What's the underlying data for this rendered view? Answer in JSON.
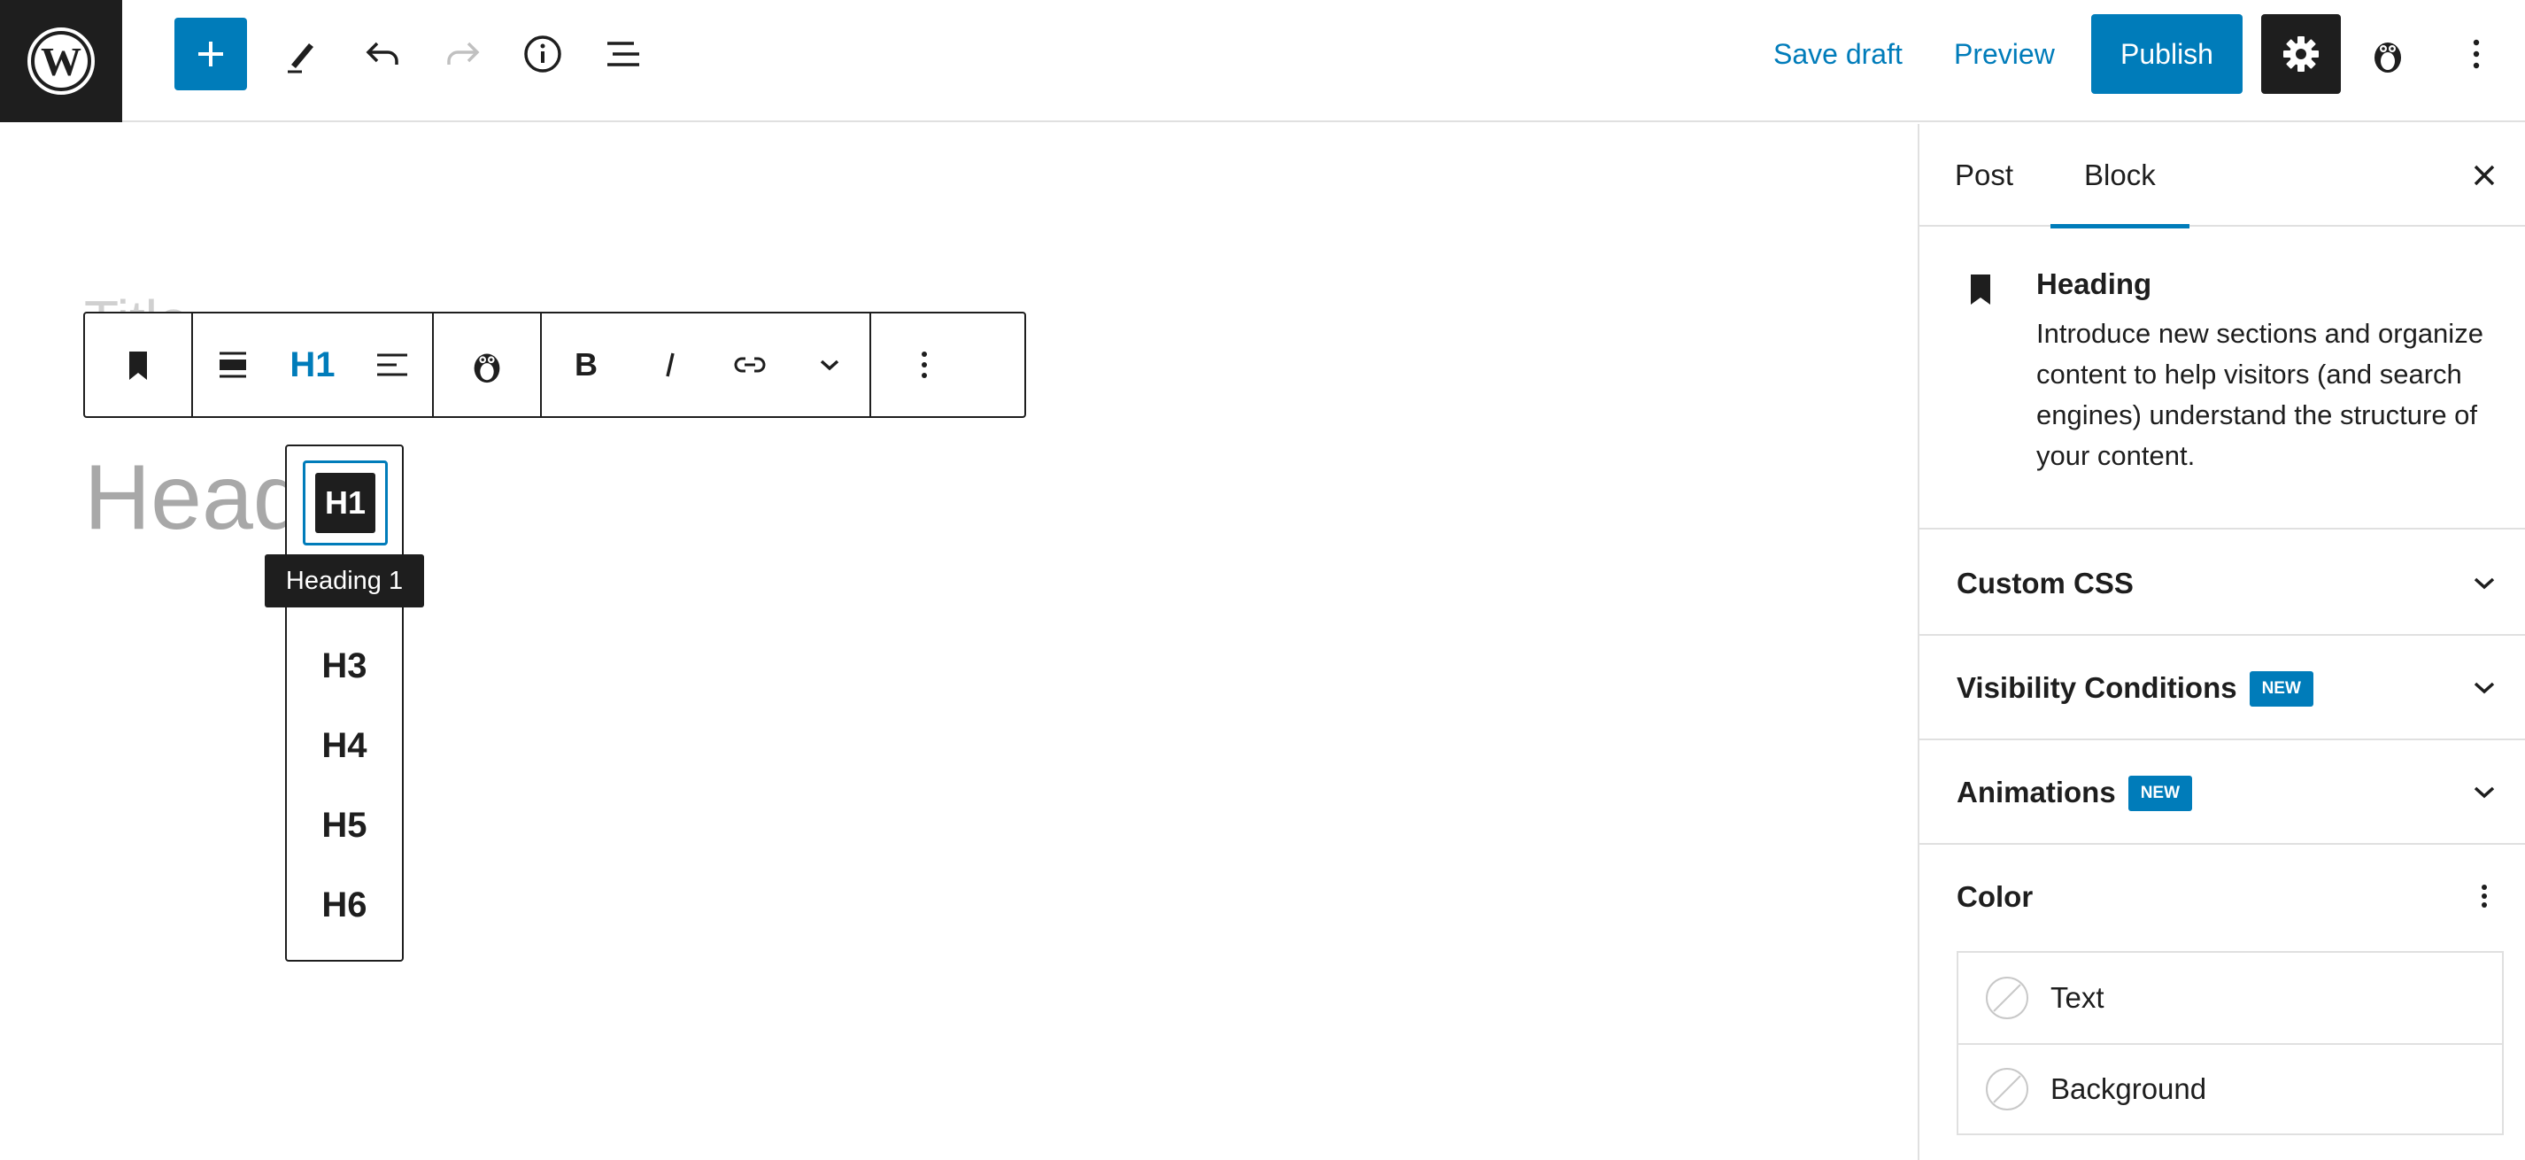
{
  "topbar": {
    "logo_icon": "wordpress-logo-icon",
    "save_draft": "Save draft",
    "preview": "Preview",
    "publish": "Publish",
    "accent": "#007cba"
  },
  "editor": {
    "title_placeholder": "Title",
    "heading_text": "Headi",
    "toolbar": {
      "heading_level_label": "H1"
    },
    "level_menu": {
      "items": [
        "H1",
        "H3",
        "H4",
        "H5",
        "H6"
      ],
      "selected": "H1",
      "tooltip": "Heading 1"
    }
  },
  "sidebar": {
    "tabs": [
      "Post",
      "Block"
    ],
    "active_tab": "Block",
    "block": {
      "title": "Heading",
      "description": "Introduce new sections and organize content to help visitors (and search engines) understand the structure of your content."
    },
    "panels": [
      {
        "title": "Custom CSS",
        "badge": ""
      },
      {
        "title": "Visibility Conditions",
        "badge": "NEW"
      },
      {
        "title": "Animations",
        "badge": "NEW"
      }
    ],
    "color": {
      "title": "Color",
      "items": [
        "Text",
        "Background"
      ]
    }
  }
}
